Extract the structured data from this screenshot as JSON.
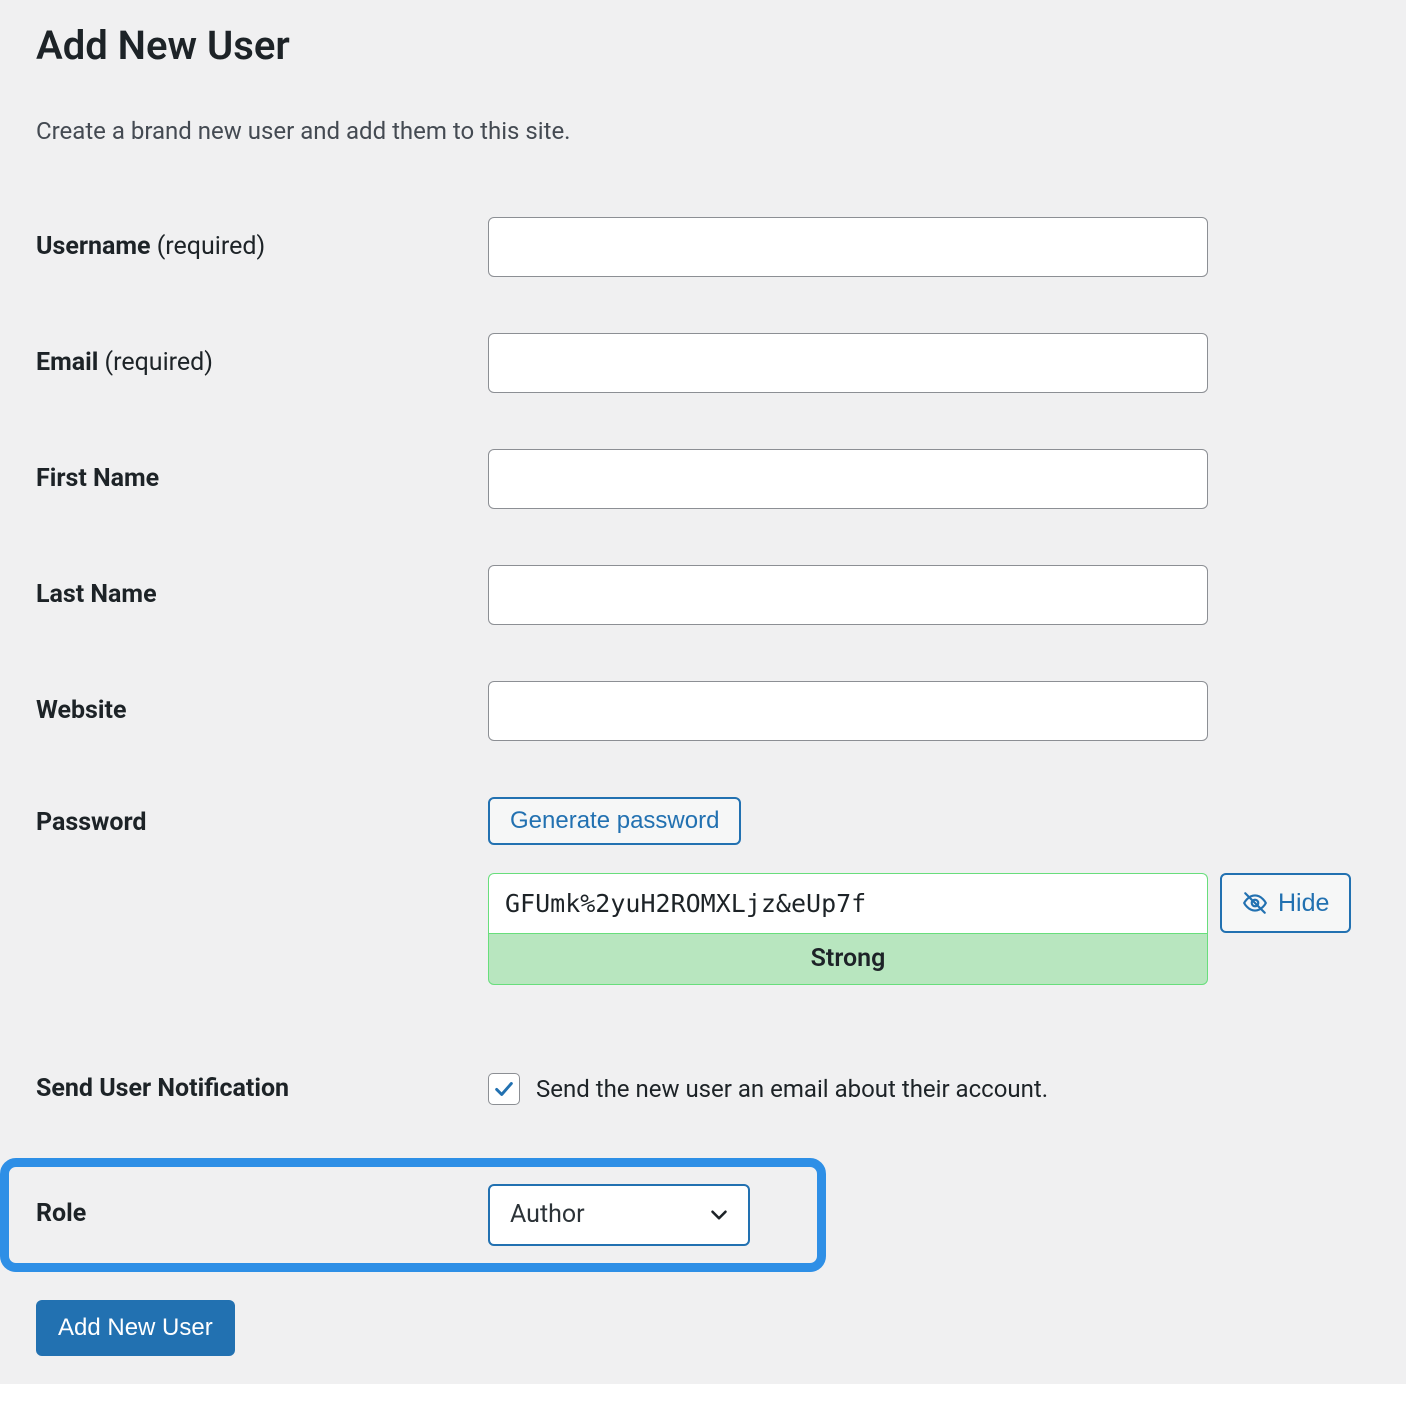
{
  "header": {
    "title": "Add New User",
    "description": "Create a brand new user and add them to this site."
  },
  "fields": {
    "username": {
      "label": "Username ",
      "required_suffix": "(required)",
      "value": ""
    },
    "email": {
      "label": "Email ",
      "required_suffix": "(required)",
      "value": ""
    },
    "first_name": {
      "label": "First Name",
      "value": ""
    },
    "last_name": {
      "label": "Last Name",
      "value": ""
    },
    "website": {
      "label": "Website",
      "value": ""
    },
    "password": {
      "label": "Password",
      "generate_button": "Generate password",
      "value": "GFUmk%2yuH2ROMXLjz&eUp7f",
      "strength_text": "Strong",
      "hide_button": "Hide"
    },
    "send_notification": {
      "label": "Send User Notification",
      "checkbox_label": "Send the new user an email about their account.",
      "checked": true
    },
    "role": {
      "label": "Role",
      "selected": "Author"
    }
  },
  "submit": {
    "label": "Add New User"
  },
  "colors": {
    "accent": "#2271b1",
    "highlight": "#2e8fe6",
    "strength_bg": "#b8e6bf",
    "strength_border": "#68de7c"
  }
}
